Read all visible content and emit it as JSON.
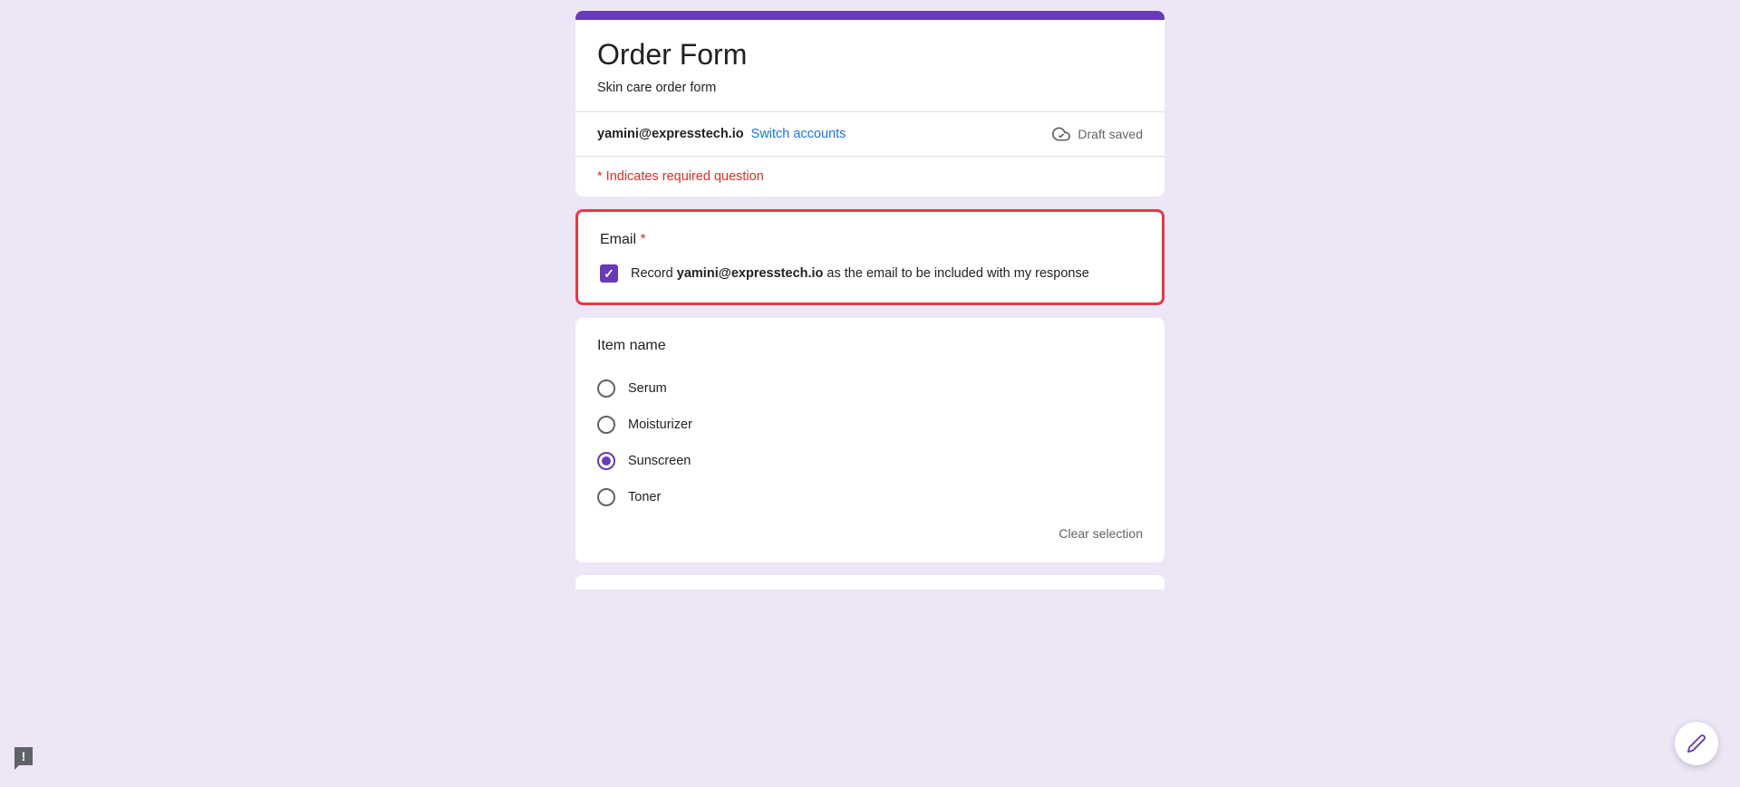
{
  "header": {
    "title": "Order Form",
    "description": "Skin care order form",
    "email": "yamini@expresstech.io",
    "switch_accounts": "Switch accounts",
    "draft_saved": "Draft saved",
    "required_note": "* Indicates required question"
  },
  "email_question": {
    "title": "Email",
    "required": "*",
    "record_prefix": "Record ",
    "record_email": "yamini@expresstech.io",
    "record_suffix": " as the email to be included with my response",
    "checked": true
  },
  "item_question": {
    "title": "Item name",
    "options": [
      {
        "label": "Serum",
        "selected": false
      },
      {
        "label": "Moisturizer",
        "selected": false
      },
      {
        "label": "Sunscreen",
        "selected": true
      },
      {
        "label": "Toner",
        "selected": false
      }
    ],
    "clear_selection": "Clear selection"
  },
  "icons": {
    "feedback": "!",
    "edit": "edit"
  }
}
